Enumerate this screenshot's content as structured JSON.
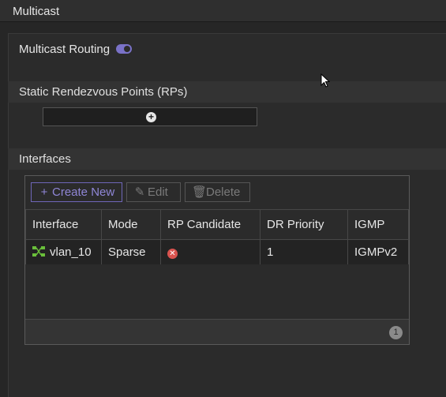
{
  "window": {
    "title": "Multicast"
  },
  "multicast_routing": {
    "label": "Multicast Routing",
    "enabled": true
  },
  "sections": {
    "static_rps": {
      "title": "Static Rendezvous Points (RPs)"
    },
    "interfaces": {
      "title": "Interfaces"
    }
  },
  "toolbar": {
    "create_label": "Create New",
    "edit_label": "Edit",
    "delete_label": "Delete"
  },
  "table": {
    "columns": [
      "Interface",
      "Mode",
      "RP Candidate",
      "DR Priority",
      "IGMP"
    ],
    "rows": [
      {
        "interface": "vlan_10",
        "mode": "Sparse",
        "rp_candidate": "disabled",
        "dr_priority": "1",
        "igmp": "IGMPv2"
      }
    ]
  },
  "pagination": {
    "count": "1"
  },
  "colors": {
    "accent": "#7a72c8",
    "error": "#d9534f"
  }
}
